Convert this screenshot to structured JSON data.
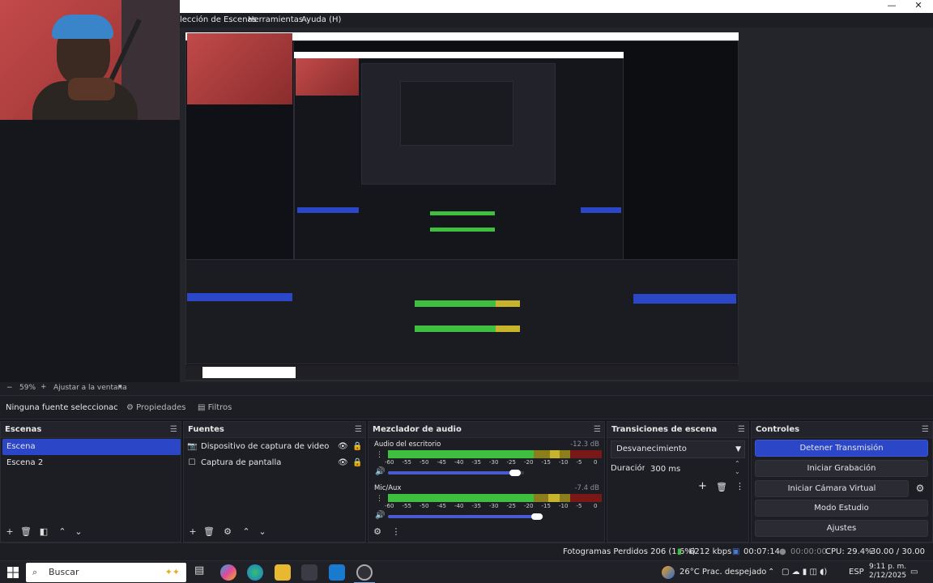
{
  "window": {
    "minimize_glyph": "—",
    "maximize_glyph": "☐",
    "close_glyph": "✕"
  },
  "menu": {
    "items": [
      "lección de Escenas",
      "Herramientas",
      "Ayuda (H)"
    ]
  },
  "zoom": {
    "minus": "−",
    "value": "59%",
    "plus": "+",
    "fit_label": "Ajustar a la ventana",
    "dropdown_glyph": "▾"
  },
  "context": {
    "selection_label": "Ninguna fuente seleccionac",
    "properties_label": "Propiedades",
    "filters_label": "Filtros",
    "properties_icon": "gear-icon",
    "filters_icon": "filter-icon"
  },
  "scenes": {
    "title": "Escenas",
    "items": [
      {
        "label": "Escena",
        "active": true
      },
      {
        "label": "Escena 2",
        "active": false
      }
    ]
  },
  "sources": {
    "title": "Fuentes",
    "items": [
      {
        "label": "Dispositivo de captura de video",
        "icon": "camera-icon"
      },
      {
        "label": "Captura de pantalla",
        "icon": "monitor-icon"
      }
    ]
  },
  "mixer": {
    "title": "Mezclador de audio",
    "channels": [
      {
        "name": "Audio del escritorio",
        "db": "-12.3 dB",
        "volume": 0.82
      },
      {
        "name": "Mic/Aux",
        "db": "-7.4 dB",
        "volume": 0.88
      }
    ],
    "ticks": [
      "-60",
      "-55",
      "-50",
      "-45",
      "-40",
      "-35",
      "-30",
      "-25",
      "-20",
      "-15",
      "-10",
      "-5",
      "0"
    ]
  },
  "transitions": {
    "title": "Transiciones de escena",
    "selected": "Desvanecimiento",
    "duration_label": "Duración",
    "duration_value": "300 ms"
  },
  "controls": {
    "title": "Controles",
    "buttons": [
      "Detener Transmisión",
      "Iniciar Grabación",
      "Iniciar Cámara Virtual",
      "Modo Estudio",
      "Ajustes"
    ]
  },
  "status": {
    "dropped_frames": "Fotogramas Perdidos 206 (1.6%)",
    "bitrate": "6212 kbps",
    "stream_time": "00:07:14",
    "record_time": "00:00:00",
    "cpu": "CPU: 29.4%",
    "fps": "30.00 / 30.00 FPS"
  },
  "taskbar": {
    "search_placeholder": "Buscar",
    "weather": "26°C  Prac. despejado",
    "language": "ESP",
    "time": "9:11 p. m.",
    "date": "2/12/2025"
  },
  "colors": {
    "accent": "#2b47c8",
    "meter_green": "#3fbf3f",
    "meter_yellow": "#c8b42c",
    "meter_red": "#a02020"
  }
}
